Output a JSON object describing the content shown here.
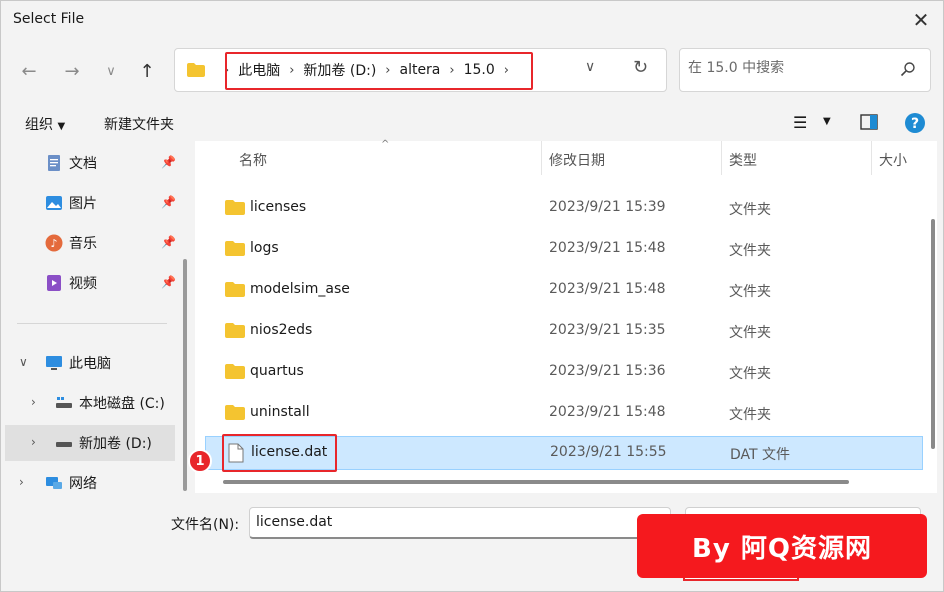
{
  "window": {
    "title": "Select File"
  },
  "address": {
    "crumbs": [
      "此电脑",
      "新加卷 (D:)",
      "altera",
      "15.0"
    ]
  },
  "search": {
    "placeholder": "在 15.0 中搜索"
  },
  "toolbar": {
    "organize_label": "组织",
    "new_folder_label": "新建文件夹"
  },
  "nav": {
    "quick": [
      {
        "label": "文档",
        "icon": "document-icon"
      },
      {
        "label": "图片",
        "icon": "picture-icon"
      },
      {
        "label": "音乐",
        "icon": "music-icon"
      },
      {
        "label": "视频",
        "icon": "video-icon"
      }
    ],
    "this_pc": "此电脑",
    "drives": [
      {
        "label": "本地磁盘 (C:)"
      },
      {
        "label": "新加卷 (D:)"
      }
    ],
    "network": "网络"
  },
  "columns": {
    "name": "名称",
    "date": "修改日期",
    "type": "类型",
    "size": "大小"
  },
  "files": [
    {
      "name": "licenses",
      "date": "2023/9/21 15:39",
      "type": "文件夹",
      "kind": "folder"
    },
    {
      "name": "logs",
      "date": "2023/9/21 15:48",
      "type": "文件夹",
      "kind": "folder"
    },
    {
      "name": "modelsim_ase",
      "date": "2023/9/21 15:48",
      "type": "文件夹",
      "kind": "folder"
    },
    {
      "name": "nios2eds",
      "date": "2023/9/21 15:35",
      "type": "文件夹",
      "kind": "folder"
    },
    {
      "name": "quartus",
      "date": "2023/9/21 15:36",
      "type": "文件夹",
      "kind": "folder"
    },
    {
      "name": "uninstall",
      "date": "2023/9/21 15:48",
      "type": "文件夹",
      "kind": "folder"
    },
    {
      "name": "license.dat",
      "date": "2023/9/21 15:55",
      "type": "DAT 文件",
      "kind": "file"
    }
  ],
  "annotation": {
    "step": "1"
  },
  "bottom": {
    "filename_label": "文件名(N):",
    "filename_value": "license.dat"
  },
  "watermark": "By 阿Q资源网",
  "colors": {
    "highlight_red": "#e8262b",
    "selection": "#cde8ff",
    "folder": "#f4c430"
  }
}
